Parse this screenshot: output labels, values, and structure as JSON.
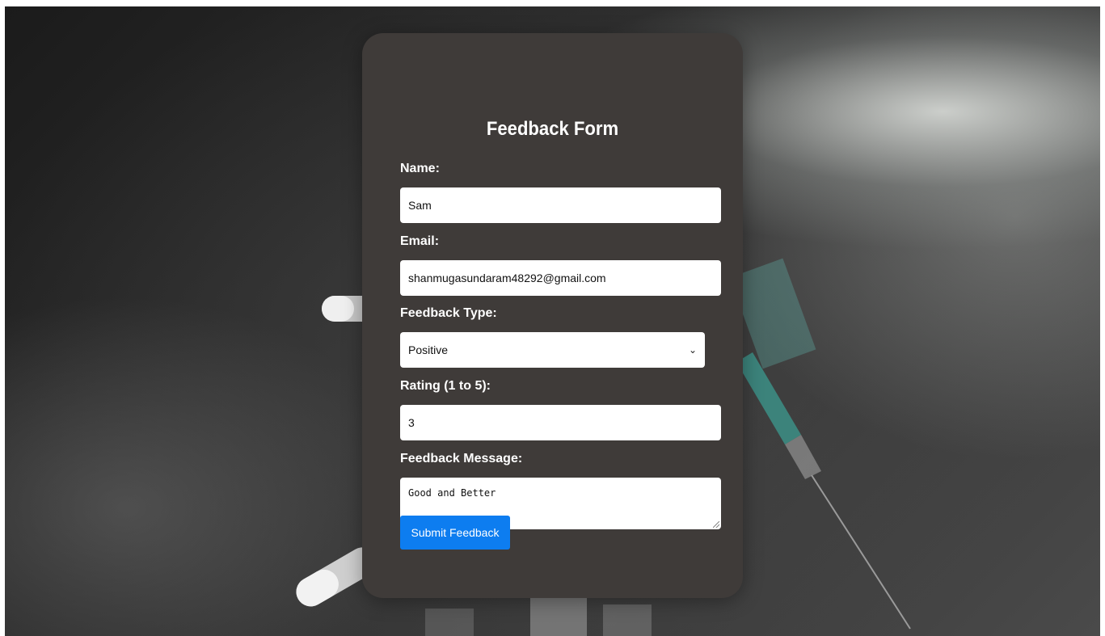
{
  "form": {
    "title": "Feedback Form",
    "name_label": "Name:",
    "name_value": "Sam",
    "email_label": "Email:",
    "email_value": "shanmugasundaram48292@gmail.com",
    "type_label": "Feedback Type:",
    "type_value": "Positive",
    "rating_label": "Rating (1 to 5):",
    "rating_value": "3",
    "message_label": "Feedback Message:",
    "message_value": "Good and Better",
    "submit_label": "Submit Feedback"
  },
  "colors": {
    "card_background": "#3f3b39",
    "button_background": "#0d7df0",
    "label_text": "#ffffff"
  },
  "icons": {
    "select": "chevron-down-icon",
    "textarea": "resize-handle-icon"
  }
}
